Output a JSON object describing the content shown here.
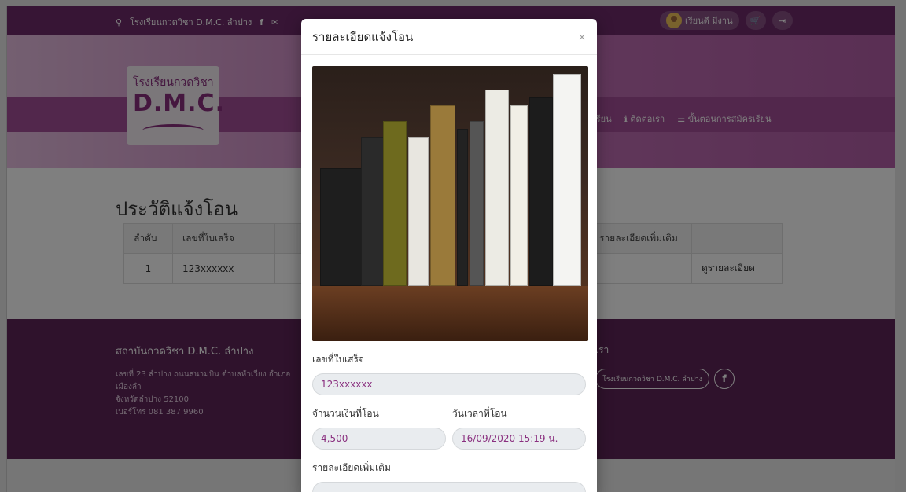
{
  "topbar": {
    "school_name": "โรงเรียนกวดวิชา D.M.C. ลำปาง",
    "user_name": "เรียนดี มีงาน"
  },
  "logo": {
    "line1": "โรงเรียนกวดวิชา",
    "line2": "D.M.C."
  },
  "nav": {
    "items": [
      "เรียน",
      "ติดต่อเรา",
      "ขั้นตอนการสมัครเรียน"
    ]
  },
  "history": {
    "title": "ประวัติแจ้งโอน",
    "columns": [
      "ลำดับ",
      "เลขที่ใบเสร็จ",
      "",
      "รายละเอียดเพิ่มเติม",
      ""
    ],
    "rows": [
      {
        "no": "1",
        "receipt": "123xxxxxx",
        "action": "ดูรายละเอียด"
      }
    ]
  },
  "footer": {
    "org": "สถาบันกวดวิชา D.M.C. ลำปาง",
    "addr1": "เลขที่ 23 ลำปาง ถนนสนามบิน ตำบลหัวเวียง อำเภอเมืองลำ",
    "addr2": "จังหวัดลำปาง 52100",
    "phone": "เบอร์โทร 081 387 9960",
    "contact_title": "เรา",
    "social_label": "โรงเรียนกวดวิชา D.M.C. ลำปาง"
  },
  "modal": {
    "title": "รายละเอียดแจ้งโอน",
    "close": "×",
    "receipt_label": "เลขที่ใบเสร็จ",
    "receipt_value": "123xxxxxx",
    "amount_label": "จำนวนเงินที่โอน",
    "amount_value": "4,500",
    "datetime_label": "วันเวลาที่โอน",
    "datetime_value": "16/09/2020 15:19 น.",
    "note_label": "รายละเอียดเพิ่มเติม",
    "note_value": ""
  },
  "colors": {
    "primary": "#6e2a6a",
    "accent": "#8a2f7f"
  }
}
